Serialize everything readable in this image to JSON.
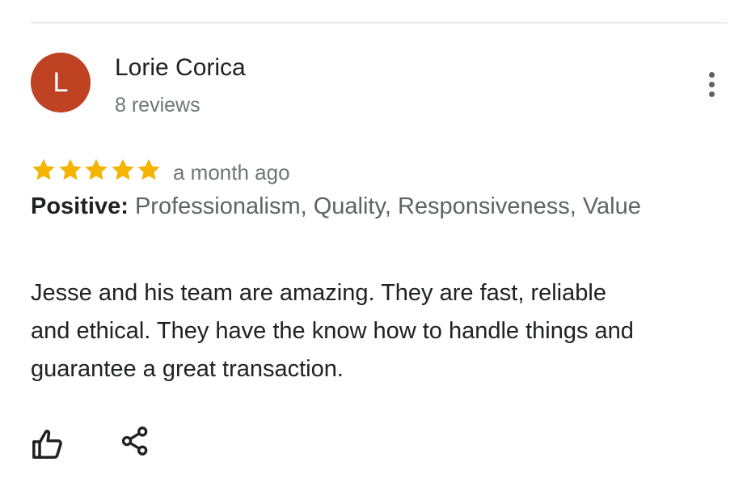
{
  "review": {
    "reviewer": {
      "initial": "L",
      "name": "Lorie Corica",
      "review_count": "8 reviews",
      "avatar_color": "#bf4223"
    },
    "more_options_icon": "more-vert-icon",
    "rating": {
      "stars": 5,
      "max_stars": 5,
      "star_color": "#f4b400"
    },
    "date": "a month ago",
    "attributes": {
      "label": "Positive:",
      "values": "Professionalism, Quality, Responsiveness, Value"
    },
    "text": "Jesse and his team are amazing.  They are fast, reliable and ethical.  They have the know how to handle things and guarantee a great transaction.",
    "actions": {
      "like_icon": "thumbs-up-icon",
      "share_icon": "share-icon"
    }
  }
}
